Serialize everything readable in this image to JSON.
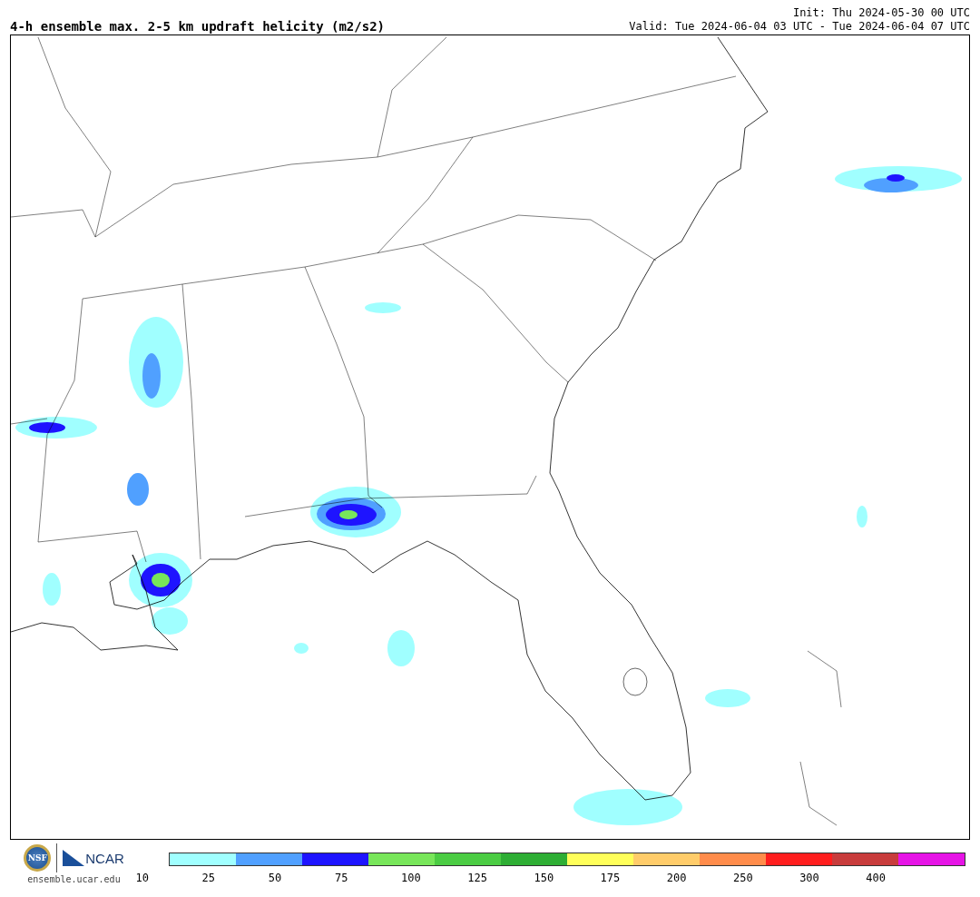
{
  "title": "4-h ensemble max. 2-5 km updraft helicity (m2/s2)",
  "init": "Init: Thu 2024-05-30 00 UTC",
  "valid": "Valid: Tue 2024-06-04 03 UTC - Tue 2024-06-04 07 UTC",
  "logos": {
    "nsf": "NSF",
    "ncar": "NCAR",
    "url": "ensemble.ucar.edu"
  },
  "colorbar": {
    "segments": [
      {
        "color": "#a0ffff"
      },
      {
        "color": "#50a0ff"
      },
      {
        "color": "#1e14ff"
      },
      {
        "color": "#78e65a"
      },
      {
        "color": "#4bcc43"
      },
      {
        "color": "#2eae34"
      },
      {
        "color": "#ffff5a"
      },
      {
        "color": "#ffcc6a"
      },
      {
        "color": "#ff8c4b"
      },
      {
        "color": "#ff1e1e"
      },
      {
        "color": "#c83c3c"
      },
      {
        "color": "#e614e6"
      }
    ],
    "ticks": [
      "10",
      "25",
      "50",
      "75",
      "100",
      "125",
      "150",
      "175",
      "200",
      "250",
      "300",
      "400"
    ]
  }
}
